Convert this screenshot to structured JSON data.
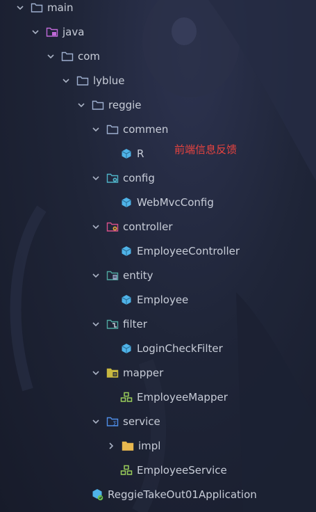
{
  "tree": {
    "main": "main",
    "java": "java",
    "com": "com",
    "lyblue": "lyblue",
    "reggie": "reggie",
    "commen": "commen",
    "r": "R",
    "config": "config",
    "webmvcconfig": "WebMvcConfig",
    "controller": "controller",
    "employeecontroller": "EmployeeController",
    "entity": "entity",
    "employee": "Employee",
    "filter": "filter",
    "logincheckfilter": "LoginCheckFilter",
    "mapper": "mapper",
    "employeemapper": "EmployeeMapper",
    "service": "service",
    "impl": "impl",
    "employeeservice": "EmployeeService",
    "app": "ReggieTakeOut01Application"
  },
  "annotation": "前端信息反馈",
  "colors": {
    "text": "#c8cdd8",
    "annotation": "#e8433f",
    "class_icon": "#4fb3e8",
    "interface_icon": "#9acd5a",
    "folder_outline": "#9fb0d0"
  }
}
